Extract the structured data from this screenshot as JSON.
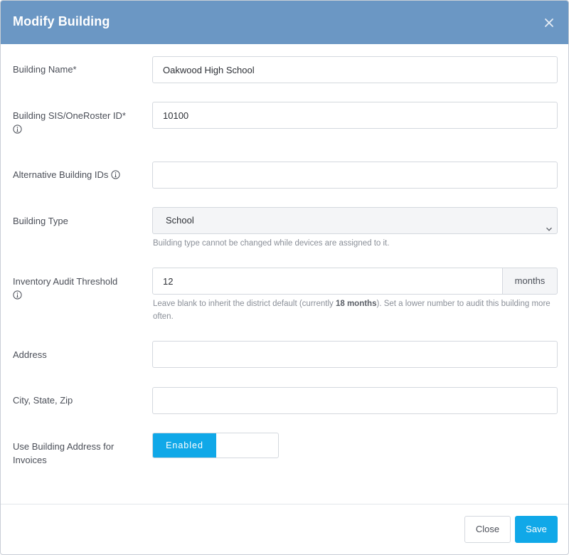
{
  "modal": {
    "title": "Modify Building"
  },
  "form": {
    "building_name": {
      "label": "Building Name*",
      "value": "Oakwood High School"
    },
    "sis_id": {
      "label": "Building SIS/OneRoster ID*",
      "value": "10100"
    },
    "alt_ids": {
      "label": "Alternative Building IDs",
      "value": ""
    },
    "building_type": {
      "label": "Building Type",
      "selected": "School",
      "help": "Building type cannot be changed while devices are assigned to it."
    },
    "audit_threshold": {
      "label": "Inventory Audit Threshold",
      "value": "12",
      "unit": "months",
      "help_before": "Leave blank to inherit the district default (currently ",
      "help_bold": "18 months",
      "help_after": "). Set a lower number to audit this building more often."
    },
    "address": {
      "label": "Address",
      "value": ""
    },
    "city_state_zip": {
      "label": "City, State, Zip",
      "value": ""
    },
    "invoice_address": {
      "label": "Use Building Address for Invoices",
      "toggle_label": "Enabled",
      "enabled": true
    }
  },
  "footer": {
    "close_label": "Close",
    "save_label": "Save"
  },
  "colors": {
    "header": "#6b97c4",
    "primary": "#10a8e8"
  },
  "icons": {
    "close": "close-icon",
    "info": "info-icon",
    "chevron": "chevron-down-icon"
  }
}
